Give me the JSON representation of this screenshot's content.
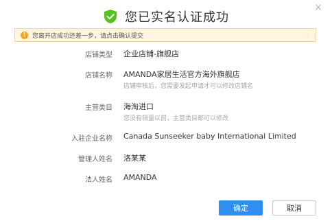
{
  "dialog": {
    "close_glyph": "×",
    "title": "您已实名认证成功",
    "notice": "您离开店成功还差一步，请点击确认提交",
    "fields": [
      {
        "label": "店铺类型",
        "value": "企业店铺-旗舰店",
        "hint": ""
      },
      {
        "label": "店铺名称",
        "value": "AMANDA家居生活官方海外旗舰店",
        "hint": "店铺审核后，您需要发起申请才可以修改店铺名"
      },
      {
        "label": "主营类目",
        "value": "海淘进口",
        "hint": "您没有销量以前，主营类目都可以修改"
      },
      {
        "label": "入驻企业名称",
        "value": "Canada Sunseeker baby International Limited",
        "hint": ""
      },
      {
        "label": "管理人姓名",
        "value": "洛某某",
        "hint": ""
      },
      {
        "label": "法人姓名",
        "value": "AMANDA",
        "hint": ""
      }
    ],
    "confirm_label": "确定",
    "cancel_label": "取消"
  },
  "colors": {
    "success": "#52c41a",
    "warning": "#f5a623",
    "primary": "#2f8ff0",
    "notice_bg": "#fff5e0"
  },
  "icons": {
    "success": "check-shield-icon",
    "warning": "exclamation-circle-icon",
    "close": "close-icon"
  }
}
